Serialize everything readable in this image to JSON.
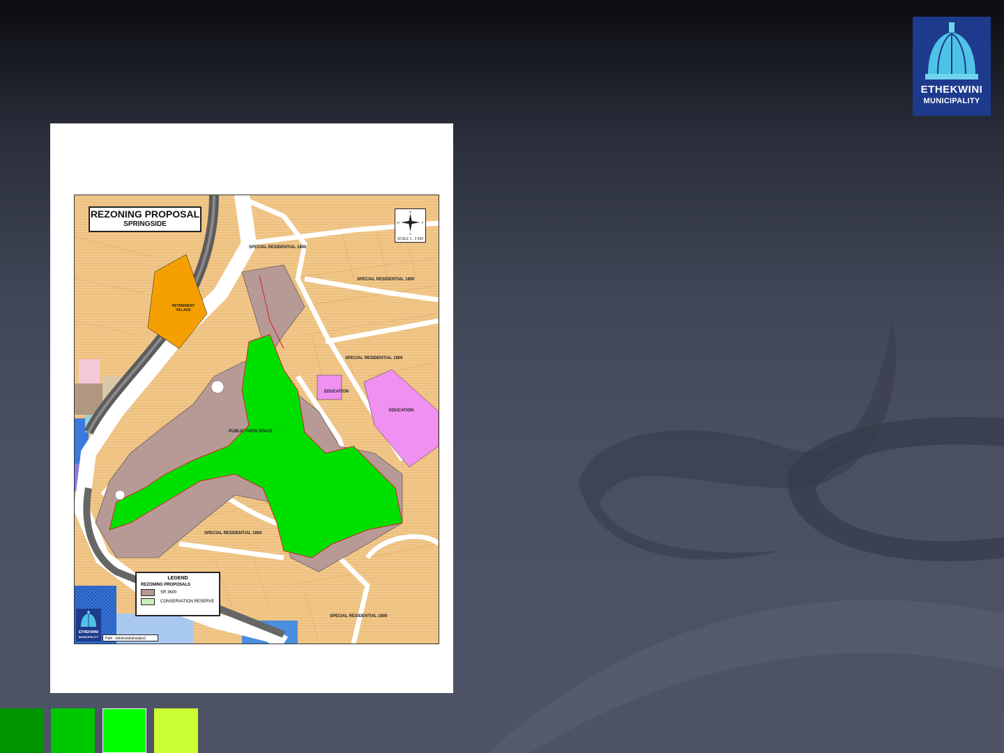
{
  "header": {
    "logo_line1": "ETHEKWINI",
    "logo_line2": "MUNICIPALITY"
  },
  "map": {
    "title": "REZONING PROPOSAL",
    "subtitle": "SPRINGSIDE",
    "compass": {
      "n": "N",
      "s": "S",
      "e": "E",
      "w": "W",
      "scale": "SCALE 1 : 3 500"
    },
    "zones": [
      "SPECIAL RESIDENTIAL 1800",
      "SPECIAL RESIDENTIAL 1800",
      "RETIREMENT VILLAGE",
      "SPECIAL RESIDENTIAL 1800",
      "EDUCATION",
      "EDUCATION",
      "PUBLIC OPEN SPACE",
      "SPECIAL RESIDENTIAL 1800",
      "SPECIAL RESIDENTIAL 1800"
    ],
    "legend": {
      "heading": "LEGEND",
      "section": "REZONING PROPOSALS",
      "items": [
        {
          "label": "SR 3600",
          "color": "#b79a96"
        },
        {
          "label": "CONSERVATION RESERVE",
          "color": "#c8f0b8"
        }
      ]
    },
    "mini_logo_line1": "ETHEKWINI",
    "mini_logo_line2": "MUNICIPALITY",
    "path": "Path : t/ahsha/ahsha/gba1"
  },
  "colors": {
    "residential": "#f2c98a",
    "sr3600": "#b79a96",
    "open_space": "#00e000",
    "retirement": "#f5a000",
    "education": "#f090f0",
    "road": "#ffffff",
    "railway": "#555555",
    "brand": "#1d3a8c",
    "swatches": [
      "#009400",
      "#00c800",
      "#00ff00",
      "#ccff33"
    ]
  }
}
